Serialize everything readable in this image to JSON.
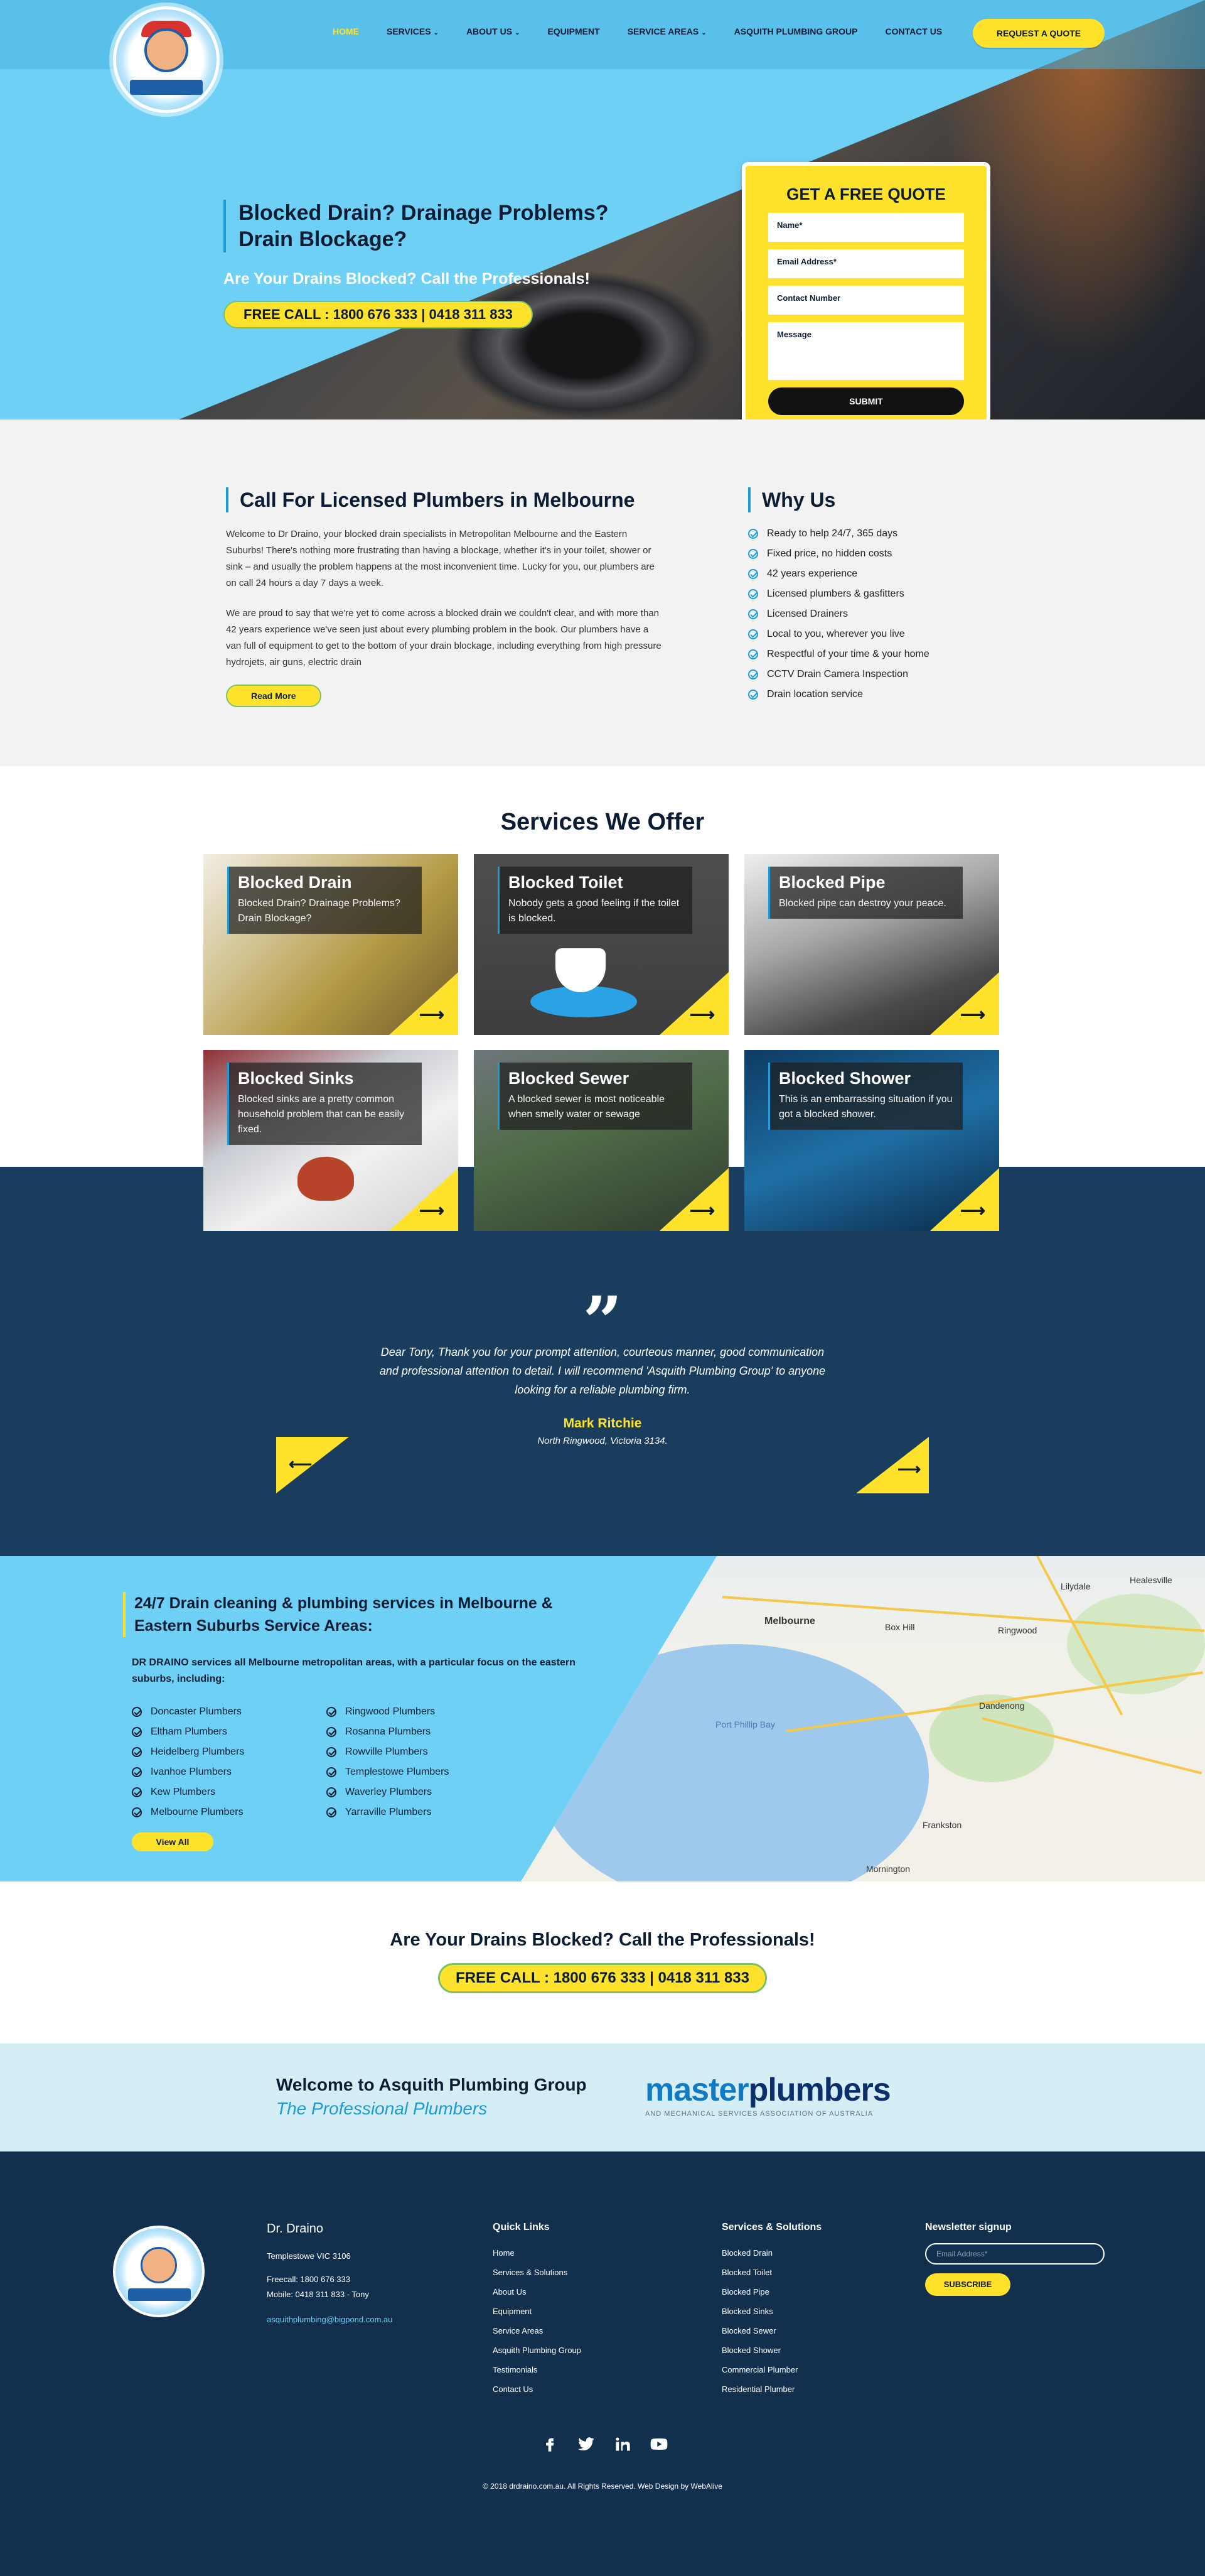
{
  "nav": {
    "items": [
      {
        "label": "HOME",
        "active": true
      },
      {
        "label": "SERVICES",
        "has_dropdown": true
      },
      {
        "label": "ABOUT US",
        "has_dropdown": true
      },
      {
        "label": "EQUIPMENT"
      },
      {
        "label": "SERVICE AREAS",
        "has_dropdown": true
      },
      {
        "label": "ASQUITH PLUMBING GROUP"
      },
      {
        "label": "CONTACT US"
      }
    ],
    "cta": "REQUEST A QUOTE"
  },
  "hero": {
    "heading": "Blocked Drain? Drainage Problems? Drain Blockage?",
    "subheading": "Are Your Drains Blocked? Call the Professionals!",
    "call": "FREE CALL : 1800 676 333 | 0418 311 833"
  },
  "quote_form": {
    "title": "GET A FREE QUOTE",
    "name": "Name*",
    "email": "Email Address*",
    "phone": "Contact Number",
    "message": "Message",
    "submit": "SUBMIT"
  },
  "about": {
    "heading": "Call For Licensed Plumbers in Melbourne",
    "p1": "Welcome to Dr Draino, your blocked drain specialists in Metropolitan Melbourne and the Eastern Suburbs! There's nothing more frustrating than having a blockage, whether it's in your toilet, shower or sink – and usually the problem happens at the most inconvenient time. Lucky for you, our plumbers are on call 24 hours a day 7 days a week.",
    "p2": "We are proud to say that we're yet to come across a blocked drain we couldn't clear, and with more than 42 years experience we've seen just about every plumbing problem in the book. Our plumbers have a van full of equipment to get to the bottom of your drain blockage, including everything from high pressure hydrojets, air guns, electric drain",
    "read_more": "Read More"
  },
  "why": {
    "heading": "Why Us",
    "items": [
      "Ready to help 24/7, 365 days",
      "Fixed price, no hidden costs",
      "42 years experience",
      "Licensed plumbers & gasfitters",
      "Licensed Drainers",
      "Local to you, wherever you live",
      "Respectful of your time & your home",
      "CCTV Drain Camera Inspection",
      "Drain location service"
    ]
  },
  "services": {
    "title": "Services We Offer",
    "cards": [
      {
        "title": "Blocked Drain",
        "text": "Blocked Drain? Drainage Problems? Drain Blockage?"
      },
      {
        "title": "Blocked Toilet",
        "text": "Nobody gets a good feeling if the toilet is blocked."
      },
      {
        "title": "Blocked Pipe",
        "text": "Blocked pipe can destroy your peace."
      },
      {
        "title": "Blocked Sinks",
        "text": "Blocked sinks are a pretty common household problem that can be easily fixed."
      },
      {
        "title": "Blocked Sewer",
        "text": "A blocked sewer is most noticeable when smelly water or sewage"
      },
      {
        "title": "Blocked Shower",
        "text": "This is an embarrassing situation if you got a blocked shower."
      }
    ]
  },
  "testimonial": {
    "text": "Dear Tony, Thank you for your prompt attention, courteous manner, good communication and professional attention to detail. I will recommend 'Asquith Plumbing Group' to anyone looking for a reliable plumbing firm.",
    "name": "Mark Ritchie",
    "location": "North Ringwood, Victoria 3134."
  },
  "areas": {
    "heading": "24/7 Drain cleaning & plumbing services in Melbourne & Eastern Suburbs Service Areas:",
    "intro": "DR DRAINO services all Melbourne metropolitan areas, with a particular focus on the eastern suburbs, including:",
    "col1": [
      "Doncaster Plumbers",
      "Eltham Plumbers",
      "Heidelberg Plumbers",
      "Ivanhoe Plumbers",
      "Kew Plumbers",
      "Melbourne Plumbers"
    ],
    "col2": [
      "Ringwood Plumbers",
      "Rosanna Plumbers",
      "Rowville Plumbers",
      "Templestowe Plumbers",
      "Waverley Plumbers",
      "Yarraville Plumbers"
    ],
    "view_all": "View All",
    "map_labels": [
      "Melbourne",
      "Port Phillip Bay",
      "Frankston",
      "Dandenong",
      "Mornington",
      "Box Hill",
      "Ringwood",
      "Lilydale",
      "Healesville"
    ]
  },
  "cta": {
    "heading": "Are Your Drains Blocked? Call the Professionals!",
    "call": "FREE CALL : 1800 676 333 | 0418 311 833"
  },
  "welcome": {
    "heading": "Welcome to Asquith Plumbing Group",
    "tagline": "The Professional Plumbers",
    "logo_part1": "master",
    "logo_part2": "plumbers",
    "logo_sub": "AND MECHANICAL SERVICES ASSOCIATION OF AUSTRALIA"
  },
  "footer": {
    "company": "Dr. Draino",
    "address": "Templestowe VIC 3106",
    "freecall": "Freecall: 1800 676 333",
    "mobile": "Mobile: 0418 311 833 - Tony",
    "email": "asquithplumbing@bigpond.com.au",
    "quick_links_title": "Quick Links",
    "quick_links": [
      "Home",
      "Services & Solutions",
      "About Us",
      "Equipment",
      "Service Areas",
      "Asquith Plumbing Group",
      "Testimonials",
      "Contact Us"
    ],
    "services_title": "Services & Solutions",
    "services": [
      "Blocked Drain",
      "Blocked Toilet",
      "Blocked Pipe",
      "Blocked Sinks",
      "Blocked Sewer",
      "Blocked Shower",
      "Commercial Plumber",
      "Residential Plumber"
    ],
    "newsletter_title": "Newsletter signup",
    "newsletter_placeholder": "Email Address*",
    "subscribe": "SUBSCRIBE",
    "copyright": "© 2018 drdraino.com.au. All Rights Reserved. Web Design by WebAlive"
  },
  "colors": {
    "accent_yellow": "#ffe22b",
    "sky_blue": "#6fd0f6",
    "navy": "#12304e",
    "dark_text": "#0c1d33"
  }
}
